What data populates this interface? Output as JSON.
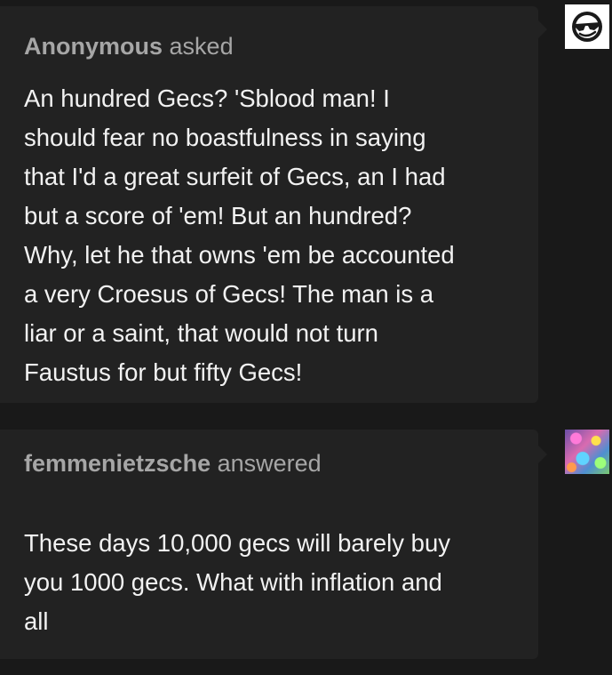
{
  "ask": {
    "asker_name": "Anonymous",
    "asker_verb": "asked",
    "question": "An hundred Gecs? 'Sblood man! I\nshould fear no boastfulness in saying\nthat I'd a great surfeit of Gecs, an I had\nbut a score of 'em! But an hundred?\nWhy, let he that owns 'em be accounted\na very Croesus of Gecs! The man is a\nliar or a saint, that would not turn\nFaustus for but fifty Gecs!"
  },
  "answer": {
    "answerer_name": "femmenietzsche",
    "answerer_verb": "answered",
    "response": "These days 10,000 gecs will barely buy\nyou 1000 gecs. What with inflation and\nall"
  },
  "icons": {
    "anonymous_avatar": "anonymous-sunglasses-icon",
    "user_avatar": "colorful-profile-avatar"
  },
  "colors": {
    "page_background": "#191919",
    "bubble_background": "#222222",
    "name_text": "#a6a6a6",
    "body_text": "#f2f2f2"
  }
}
